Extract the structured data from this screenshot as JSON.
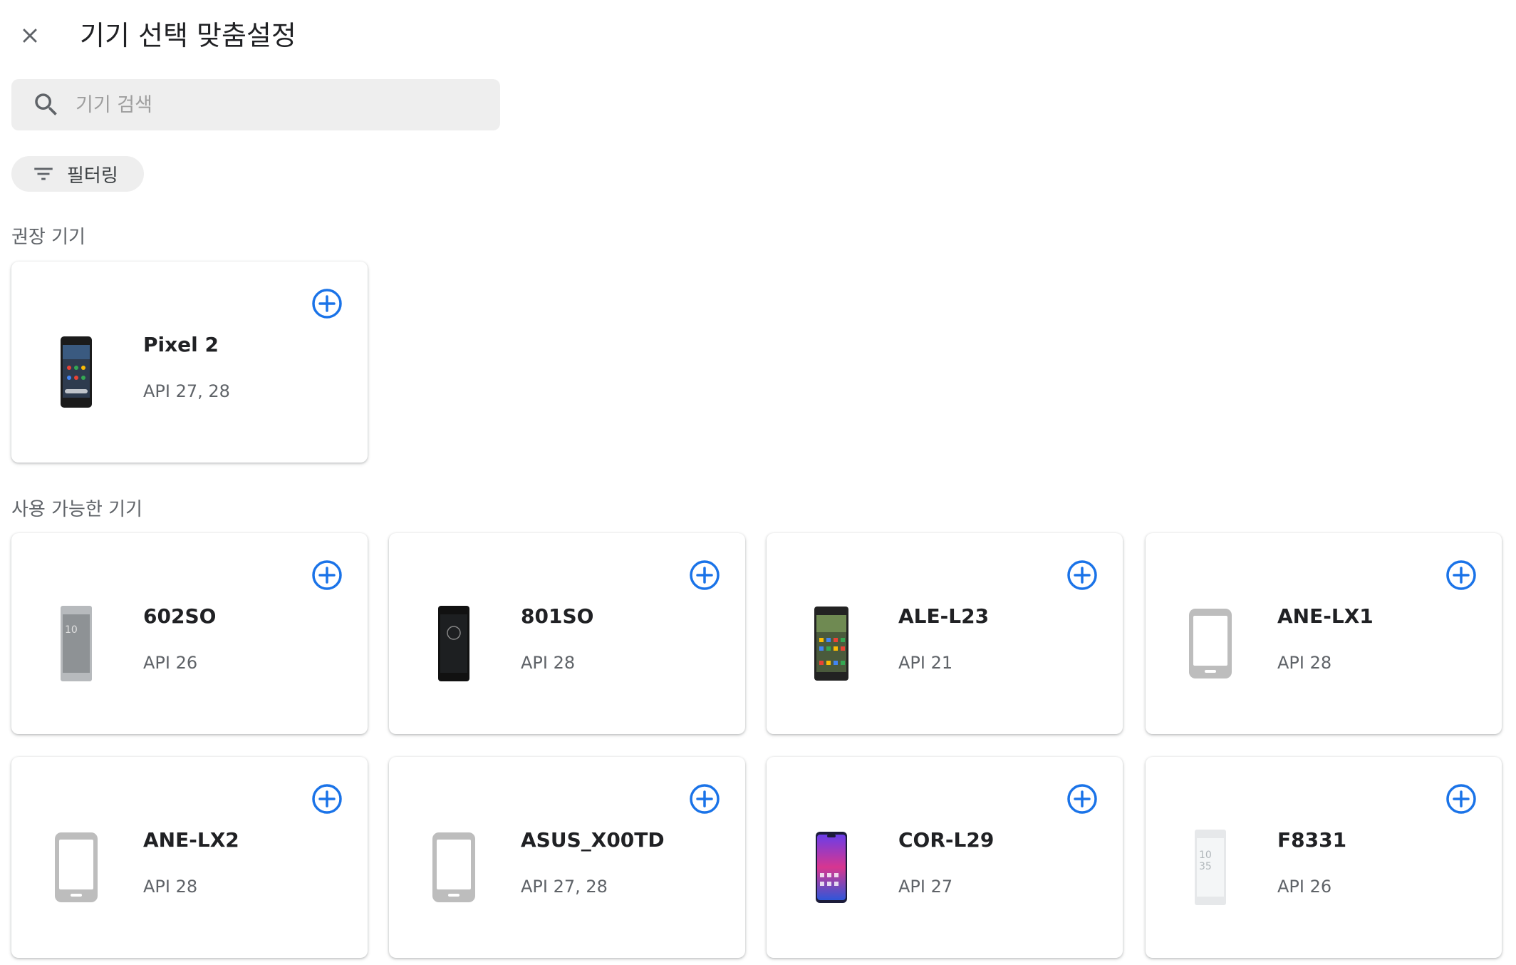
{
  "header": {
    "title": "기기 선택 맞춤설정"
  },
  "search": {
    "placeholder": "기기 검색",
    "value": ""
  },
  "filter": {
    "label": "필터링"
  },
  "sections": {
    "recommended": "권장 기기",
    "available": "사용 가능한 기기"
  },
  "recommended_devices": [
    {
      "name": "Pixel 2",
      "api": "API 27, 28",
      "image": "pixel2-dark-phone"
    }
  ],
  "available_devices": [
    {
      "name": "602SO",
      "api": "API 26",
      "image": "silver-phone"
    },
    {
      "name": "801SO",
      "api": "API 28",
      "image": "black-phone"
    },
    {
      "name": "ALE-L23",
      "api": "API 21",
      "image": "dark-phone-apps"
    },
    {
      "name": "ANE-LX1",
      "api": "API 28",
      "image": "generic-phone-icon"
    },
    {
      "name": "ANE-LX2",
      "api": "API 28",
      "image": "generic-phone-icon"
    },
    {
      "name": "ASUS_X00TD",
      "api": "API 27, 28",
      "image": "generic-phone-icon"
    },
    {
      "name": "COR-L29",
      "api": "API 27",
      "image": "colorful-phone"
    },
    {
      "name": "F8331",
      "api": "API 26",
      "image": "white-phone"
    }
  ],
  "colors": {
    "accent": "#1a73e8",
    "chip_bg": "#eeeeee",
    "secondary_text": "#5f6368"
  }
}
